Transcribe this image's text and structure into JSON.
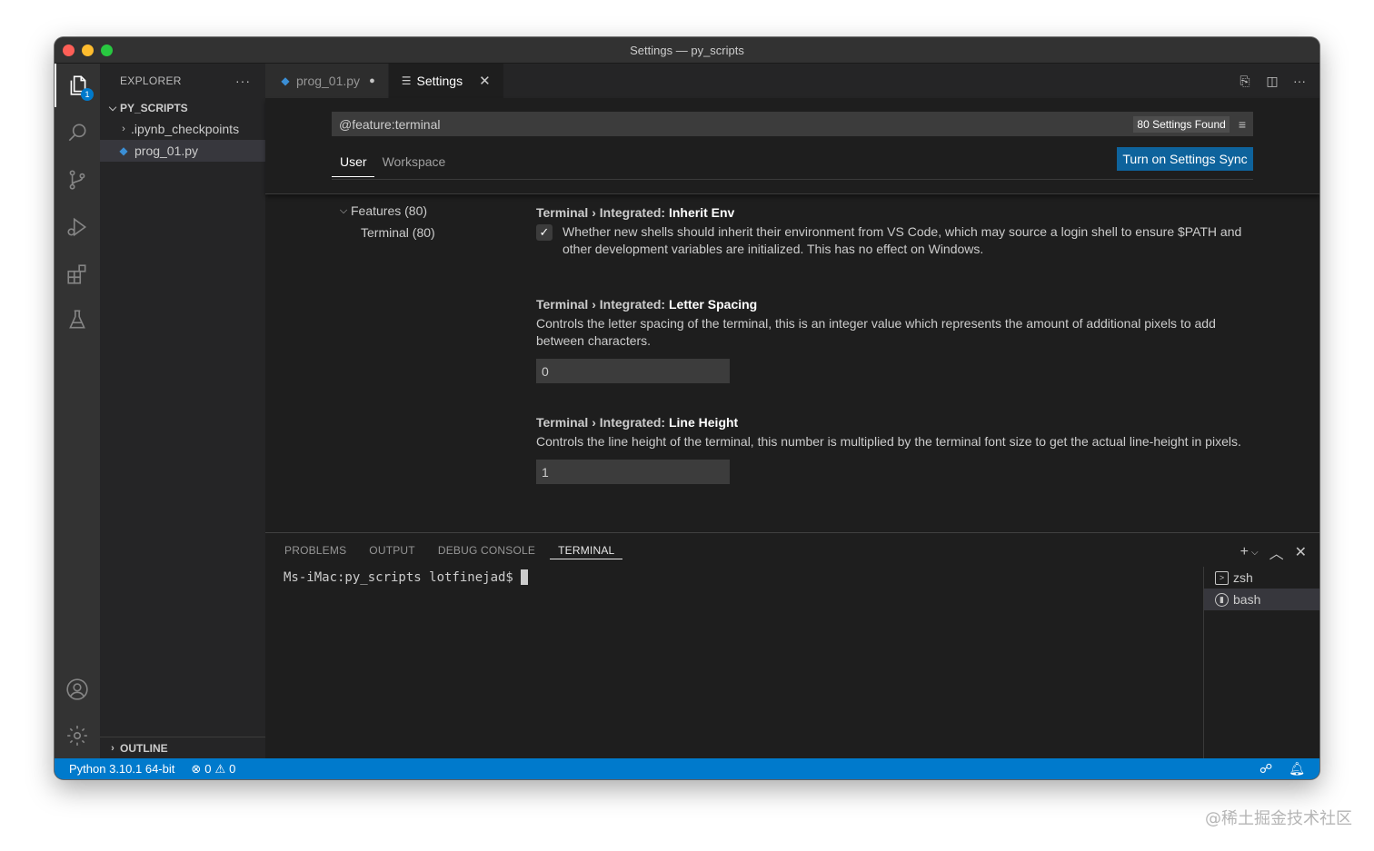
{
  "window": {
    "title": "Settings — py_scripts"
  },
  "activity_bar": {
    "items": [
      {
        "name": "explorer-icon",
        "active": true,
        "badge": "1"
      },
      {
        "name": "search-icon"
      },
      {
        "name": "source-control-icon"
      },
      {
        "name": "run-debug-icon"
      },
      {
        "name": "extensions-icon"
      },
      {
        "name": "testing-icon"
      }
    ],
    "bottom": [
      "accounts-icon",
      "manage-gear-icon"
    ]
  },
  "sidebar": {
    "header": "EXPLORER",
    "more": "···",
    "folder": "PY_SCRIPTS",
    "items": [
      {
        "label": ".ipynb_checkpoints",
        "type": "folder"
      },
      {
        "label": "prog_01.py",
        "type": "python-file",
        "selected": true
      }
    ],
    "outline": "OUTLINE"
  },
  "tabs": [
    {
      "label": "prog_01.py",
      "dirty": true,
      "active": false
    },
    {
      "label": "Settings",
      "active": true
    }
  ],
  "settings": {
    "search_value": "@feature:terminal",
    "found": "80 Settings Found",
    "scopes": [
      "User",
      "Workspace"
    ],
    "sync_button": "Turn on Settings Sync",
    "toc": [
      {
        "label": "Features (80)"
      },
      {
        "label": "Terminal (80)"
      }
    ],
    "items": [
      {
        "category": "Terminal › Integrated: ",
        "name": "Inherit Env",
        "description": "Whether new shells should inherit their environment from VS Code, which may source a login shell to ensure $PATH and other development variables are initialized. This has no effect on Windows.",
        "checked": true
      },
      {
        "category": "Terminal › Integrated: ",
        "name": "Letter Spacing",
        "description": "Controls the letter spacing of the terminal, this is an integer value which represents the amount of additional pixels to add between characters.",
        "value": "0"
      },
      {
        "category": "Terminal › Integrated: ",
        "name": "Line Height",
        "description": "Controls the line height of the terminal, this number is multiplied by the terminal font size to get the actual line-height in pixels.",
        "value": "1"
      }
    ]
  },
  "panel": {
    "tabs": [
      "PROBLEMS",
      "OUTPUT",
      "DEBUG CONSOLE",
      "TERMINAL"
    ],
    "active_tab": "TERMINAL",
    "prompt": "Ms-iMac:py_scripts lotfinejad$",
    "terminals": [
      {
        "label": "zsh"
      },
      {
        "label": "bash",
        "selected": true
      }
    ]
  },
  "statusbar": {
    "python": "Python 3.10.1 64-bit",
    "errors": "0",
    "warnings": "0"
  },
  "watermark": "@稀土掘金技术社区",
  "colors": {
    "accent": "#007acc",
    "button": "#0e639c"
  }
}
